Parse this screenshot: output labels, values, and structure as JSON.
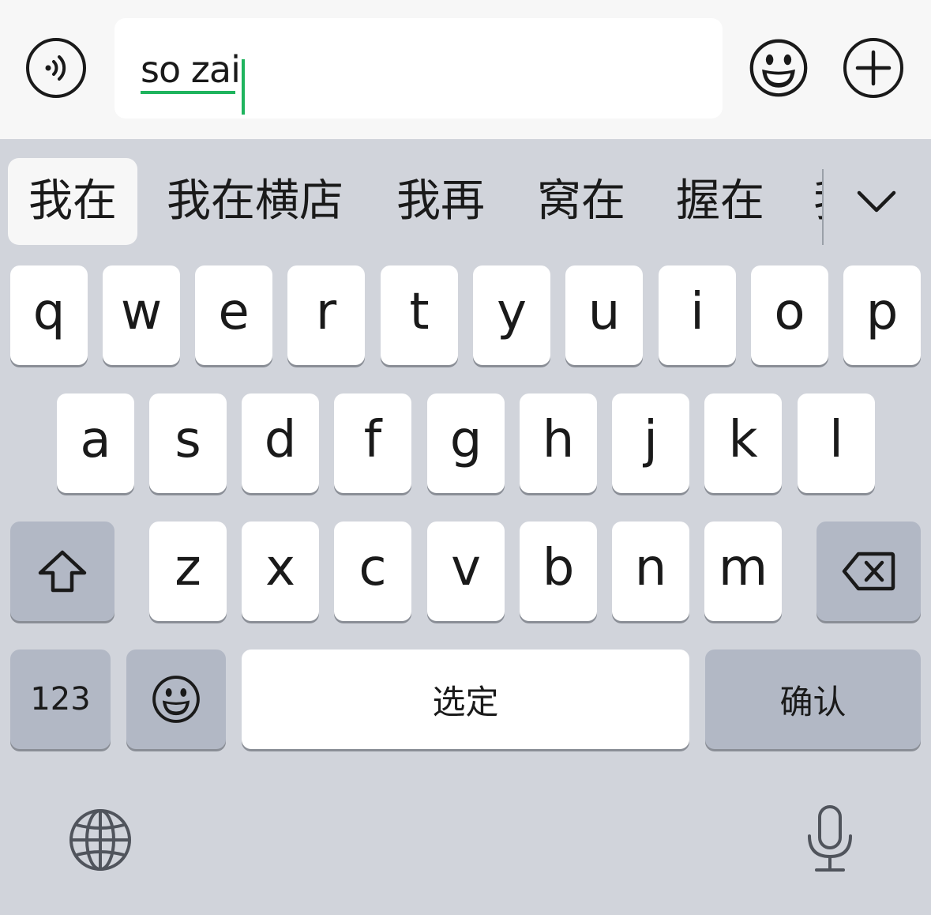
{
  "input_bar": {
    "voice_icon": "voice-icon",
    "composition_text": "so zai",
    "emoji_icon": "smiley-icon",
    "plus_icon": "plus-icon"
  },
  "candidates": [
    {
      "text": "我在",
      "selected": true
    },
    {
      "text": "我在横店",
      "selected": false
    },
    {
      "text": "我再",
      "selected": false
    },
    {
      "text": "窝在",
      "selected": false
    },
    {
      "text": "握在",
      "selected": false
    },
    {
      "text": "我",
      "selected": false
    }
  ],
  "keyboard": {
    "row1": [
      "q",
      "w",
      "e",
      "r",
      "t",
      "y",
      "u",
      "i",
      "o",
      "p"
    ],
    "row2": [
      "a",
      "s",
      "d",
      "f",
      "g",
      "h",
      "j",
      "k",
      "l"
    ],
    "row3": [
      "z",
      "x",
      "c",
      "v",
      "b",
      "n",
      "m"
    ],
    "shift_icon": "shift-icon",
    "delete_icon": "delete-icon",
    "numbers_label": "123",
    "emoji_key_icon": "smiley-icon",
    "space_label": "选定",
    "confirm_label": "确认",
    "globe_icon": "globe-icon",
    "mic_icon": "microphone-icon",
    "expand_icon": "chevron-down-icon"
  },
  "colors": {
    "composition_accent": "#1fb45e",
    "keyboard_bg": "#d1d4db",
    "function_key": "#b2b8c5"
  }
}
